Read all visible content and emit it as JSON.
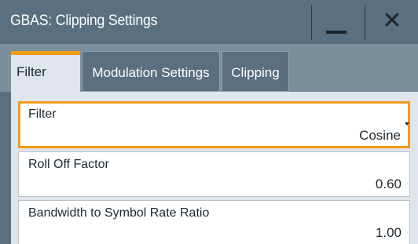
{
  "window": {
    "title": "GBAS: Clipping Settings",
    "minimize_icon": "minimize-icon",
    "close_icon": "close-icon",
    "close_glyph": "✕"
  },
  "tabs": [
    {
      "label": "Filter",
      "active": true
    },
    {
      "label": "Modulation Settings",
      "active": false
    },
    {
      "label": "Clipping",
      "active": false
    }
  ],
  "fields": {
    "filter": {
      "label": "Filter",
      "value": "Cosine"
    },
    "roll_off": {
      "label": "Roll Off Factor",
      "value": "0.60"
    },
    "bandwidth_ratio": {
      "label": "Bandwidth to Symbol Rate Ratio",
      "value": "1.00"
    }
  },
  "colors": {
    "accent": "#f39a1b",
    "titlebar": "#58707f",
    "panel": "#dfe5ea"
  }
}
